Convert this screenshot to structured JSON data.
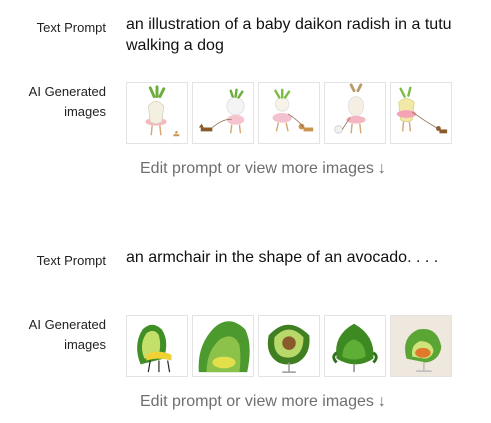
{
  "examples": [
    {
      "text_prompt_label": "Text Prompt",
      "prompt": "an illustration of a baby daikon radish in a tutu walking a dog",
      "images_label": "AI Generated images",
      "edit_link": "Edit prompt or view more images",
      "edit_arrow": "↓",
      "images": [
        "daikon-radish-tutu-1",
        "daikon-radish-tutu-2",
        "daikon-radish-tutu-3",
        "daikon-radish-tutu-4",
        "daikon-radish-tutu-5"
      ]
    },
    {
      "text_prompt_label": "Text Prompt",
      "prompt": "an armchair in the shape of an avocado. . . .",
      "images_label": "AI Generated images",
      "edit_link": "Edit prompt or view more images",
      "edit_arrow": "↓",
      "images": [
        "avocado-armchair-1",
        "avocado-armchair-2",
        "avocado-armchair-3",
        "avocado-armchair-4",
        "avocado-armchair-5"
      ]
    }
  ],
  "colors": {
    "link_gray": "#6f6f6f",
    "avocado_green": "#4a9a2a",
    "avocado_light": "#c9e36a"
  }
}
